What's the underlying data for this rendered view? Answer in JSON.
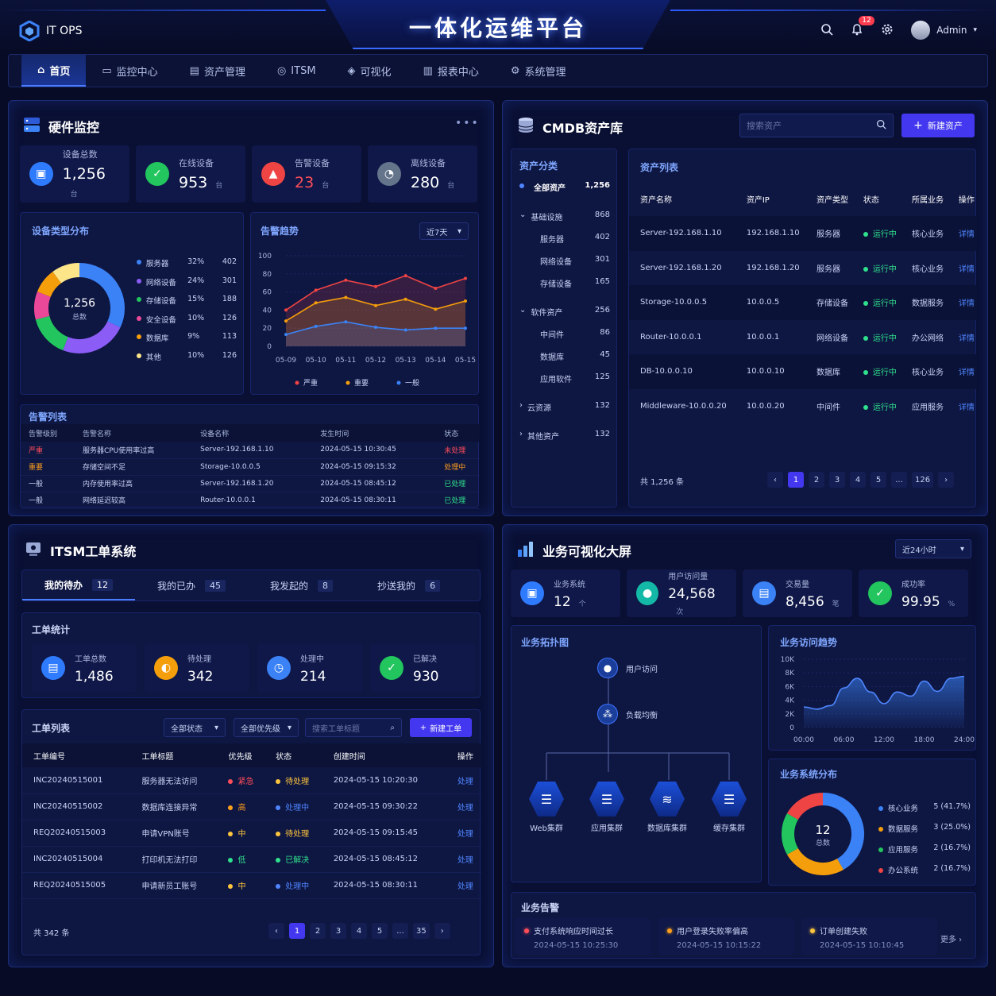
{
  "app": {
    "logo_text": "IT OPS",
    "title": "一体化运维平台",
    "notification_count": "12",
    "user_name": "Admin"
  },
  "nav": [
    {
      "label": "首页",
      "icon": "home-icon"
    },
    {
      "label": "监控中心",
      "icon": "monitor-icon"
    },
    {
      "label": "资产管理",
      "icon": "asset-icon"
    },
    {
      "label": "ITSM",
      "icon": "itsm-icon"
    },
    {
      "label": "可视化",
      "icon": "visual-icon"
    },
    {
      "label": "报表中心",
      "icon": "report-icon"
    },
    {
      "label": "系统管理",
      "icon": "gear-icon"
    }
  ],
  "hw": {
    "title": "硬件监控",
    "stats": [
      {
        "label": "设备总数",
        "value": "1,256",
        "unit": "台",
        "color": "#2f7bff"
      },
      {
        "label": "在线设备",
        "value": "953",
        "unit": "台",
        "color": "#22c55e"
      },
      {
        "label": "告警设备",
        "value": "23",
        "unit": "台",
        "color": "#ef4444"
      },
      {
        "label": "离线设备",
        "value": "280",
        "unit": "台",
        "color": "#64748b"
      }
    ],
    "type_dist": {
      "title": "设备类型分布",
      "center_value": "1,256",
      "center_label": "总数",
      "items": [
        {
          "name": "服务器",
          "pct": "32%",
          "count": "402",
          "color": "#3b82f6"
        },
        {
          "name": "网络设备",
          "pct": "24%",
          "count": "301",
          "color": "#8b5cf6"
        },
        {
          "name": "存储设备",
          "pct": "15%",
          "count": "188",
          "color": "#22c55e"
        },
        {
          "name": "安全设备",
          "pct": "10%",
          "count": "126",
          "color": "#ec4899"
        },
        {
          "name": "数据库",
          "pct": "9%",
          "count": "113",
          "color": "#f59e0b"
        },
        {
          "name": "其他",
          "pct": "10%",
          "count": "126",
          "color": "#fde68a"
        }
      ]
    },
    "alert_trend": {
      "title": "告警趋势",
      "range": "近7天"
    },
    "alert_list": {
      "title": "告警列表",
      "headers": [
        "告警级别",
        "告警名称",
        "设备名称",
        "发生时间",
        "状态"
      ],
      "rows": [
        {
          "level": "严重",
          "name": "服务器CPU使用率过高",
          "device": "Server-192.168.1.10",
          "time": "2024-05-15 10:30:45",
          "status": "未处理",
          "lc": "#ff4e5a",
          "sc": "#ff4e5a"
        },
        {
          "level": "重要",
          "name": "存储空间不足",
          "device": "Storage-10.0.0.5",
          "time": "2024-05-15 09:15:32",
          "status": "处理中",
          "lc": "#ff9f1c",
          "sc": "#ff9f1c"
        },
        {
          "level": "一般",
          "name": "内存使用率过高",
          "device": "Server-192.168.1.20",
          "time": "2024-05-15 08:45:12",
          "status": "已处理",
          "lc": "#c9d4f5",
          "sc": "#2fe08c"
        },
        {
          "level": "一般",
          "name": "网络延迟较高",
          "device": "Router-10.0.0.1",
          "time": "2024-05-15 08:30:11",
          "status": "已处理",
          "lc": "#c9d4f5",
          "sc": "#2fe08c"
        }
      ]
    }
  },
  "cmdb": {
    "title": "CMDB资产库",
    "search_placeholder": "搜索资产",
    "new_button": "新建资产",
    "cat_title": "资产分类",
    "categories": [
      {
        "name": "全部资产",
        "count": "1,256",
        "kind": "all"
      },
      {
        "name": "基础设施",
        "count": "868",
        "kind": "open"
      },
      {
        "name": "服务器",
        "count": "402",
        "kind": "child"
      },
      {
        "name": "网络设备",
        "count": "301",
        "kind": "child"
      },
      {
        "name": "存储设备",
        "count": "165",
        "kind": "child"
      },
      {
        "name": "软件资产",
        "count": "256",
        "kind": "open"
      },
      {
        "name": "中间件",
        "count": "86",
        "kind": "child"
      },
      {
        "name": "数据库",
        "count": "45",
        "kind": "child"
      },
      {
        "name": "应用软件",
        "count": "125",
        "kind": "child"
      },
      {
        "name": "云资源",
        "count": "132",
        "kind": "closed"
      },
      {
        "name": "其他资产",
        "count": "132",
        "kind": "closed"
      }
    ],
    "list_title": "资产列表",
    "headers": [
      "资产名称",
      "资产IP",
      "资产类型",
      "状态",
      "所属业务",
      "操作"
    ],
    "rows": [
      {
        "name": "Server-192.168.1.10",
        "ip": "192.168.1.10",
        "type": "服务器",
        "status": "运行中",
        "biz": "核心业务",
        "op": "详情"
      },
      {
        "name": "Server-192.168.1.20",
        "ip": "192.168.1.20",
        "type": "服务器",
        "status": "运行中",
        "biz": "核心业务",
        "op": "详情"
      },
      {
        "name": "Storage-10.0.0.5",
        "ip": "10.0.0.5",
        "type": "存储设备",
        "status": "运行中",
        "biz": "数据服务",
        "op": "详情"
      },
      {
        "name": "Router-10.0.0.1",
        "ip": "10.0.0.1",
        "type": "网络设备",
        "status": "运行中",
        "biz": "办公网络",
        "op": "详情"
      },
      {
        "name": "DB-10.0.0.10",
        "ip": "10.0.0.10",
        "type": "数据库",
        "status": "运行中",
        "biz": "核心业务",
        "op": "详情"
      },
      {
        "name": "Middleware-10.0.0.20",
        "ip": "10.0.0.20",
        "type": "中间件",
        "status": "运行中",
        "biz": "应用服务",
        "op": "详情"
      }
    ],
    "total": "共 1,256 条",
    "pages": [
      "1",
      "2",
      "3",
      "4",
      "5",
      "...",
      "126"
    ]
  },
  "itsm": {
    "title": "ITSM工单系统",
    "tabs": [
      {
        "label": "我的待办",
        "count": "12"
      },
      {
        "label": "我的已办",
        "count": "45"
      },
      {
        "label": "我发起的",
        "count": "8"
      },
      {
        "label": "抄送我的",
        "count": "6"
      }
    ],
    "stat_title": "工单统计",
    "stats": [
      {
        "label": "工单总数",
        "value": "1,486",
        "color": "#2f7bff"
      },
      {
        "label": "待处理",
        "value": "342",
        "color": "#f59e0b"
      },
      {
        "label": "处理中",
        "value": "214",
        "color": "#3b82f6"
      },
      {
        "label": "已解决",
        "value": "930",
        "color": "#22c55e"
      }
    ],
    "list_title": "工单列表",
    "filter_status": "全部状态",
    "filter_priority": "全部优先级",
    "search_placeholder": "搜索工单标题",
    "new_button": "新建工单",
    "headers": [
      "工单编号",
      "工单标题",
      "优先级",
      "状态",
      "创建时间",
      "操作"
    ],
    "rows": [
      {
        "id": "INC20240515001",
        "title": "服务器无法访问",
        "priority": "紧急",
        "pc": "#ff4e5a",
        "status": "待处理",
        "sc": "#ffc53d",
        "time": "2024-05-15 10:20:30",
        "op": "处理"
      },
      {
        "id": "INC20240515002",
        "title": "数据库连接异常",
        "priority": "高",
        "pc": "#ff9f1c",
        "status": "处理中",
        "sc": "#4f86ff",
        "time": "2024-05-15 09:30:22",
        "op": "处理"
      },
      {
        "id": "REQ20240515003",
        "title": "申请VPN账号",
        "priority": "中",
        "pc": "#ffc53d",
        "status": "待处理",
        "sc": "#ffc53d",
        "time": "2024-05-15 09:15:45",
        "op": "处理"
      },
      {
        "id": "INC20240515004",
        "title": "打印机无法打印",
        "priority": "低",
        "pc": "#2fe08c",
        "status": "已解决",
        "sc": "#2fe08c",
        "time": "2024-05-15 08:45:12",
        "op": "处理"
      },
      {
        "id": "REQ20240515005",
        "title": "申请新员工账号",
        "priority": "中",
        "pc": "#ffc53d",
        "status": "处理中",
        "sc": "#4f86ff",
        "time": "2024-05-15 08:30:11",
        "op": "处理"
      }
    ],
    "total": "共 342 条",
    "pages": [
      "1",
      "2",
      "3",
      "4",
      "5",
      "...",
      "35"
    ]
  },
  "biz": {
    "title": "业务可视化大屏",
    "range": "近24小时",
    "stats": [
      {
        "label": "业务系统",
        "value": "12",
        "unit": "个",
        "color": "#2f7bff"
      },
      {
        "label": "用户访问量",
        "value": "24,568",
        "unit": "次",
        "color": "#14b8a6"
      },
      {
        "label": "交易量",
        "value": "8,456",
        "unit": "笔",
        "color": "#3b82f6"
      },
      {
        "label": "成功率",
        "value": "99.95",
        "unit": "%",
        "color": "#22c55e"
      }
    ],
    "topo": {
      "title": "业务拓扑图",
      "user": "用户访问",
      "lb": "负载均衡",
      "clusters": [
        "Web集群",
        "应用集群",
        "数据库集群",
        "缓存集群"
      ]
    },
    "trend": {
      "title": "业务访问趋势"
    },
    "dist": {
      "title": "业务系统分布",
      "center_value": "12",
      "center_label": "总数",
      "items": [
        {
          "name": "核心业务",
          "value": "5 (41.7%)",
          "color": "#3b82f6"
        },
        {
          "name": "数据服务",
          "value": "3 (25.0%)",
          "color": "#f59e0b"
        },
        {
          "name": "应用服务",
          "value": "2 (16.7%)",
          "color": "#22c55e"
        },
        {
          "name": "办公系统",
          "value": "2 (16.7%)",
          "color": "#ef4444"
        }
      ]
    },
    "alerts": {
      "title": "业务告警",
      "more": "更多 ›",
      "items": [
        {
          "text": "支付系统响应时间过长",
          "time": "2024-05-15 10:25:30",
          "color": "#ff4e5a"
        },
        {
          "text": "用户登录失败率偏高",
          "time": "2024-05-15 10:15:22",
          "color": "#ff9f1c"
        },
        {
          "text": "订单创建失败",
          "time": "2024-05-15 10:10:45",
          "color": "#ffc53d"
        }
      ]
    }
  },
  "chart_data": [
    {
      "type": "pie",
      "title": "设备类型分布",
      "categories": [
        "服务器",
        "网络设备",
        "存储设备",
        "安全设备",
        "数据库",
        "其他"
      ],
      "values": [
        402,
        301,
        188,
        126,
        113,
        126
      ]
    },
    {
      "type": "line",
      "title": "告警趋势",
      "x": [
        "05-09",
        "05-10",
        "05-11",
        "05-12",
        "05-13",
        "05-14",
        "05-15"
      ],
      "ylim": [
        0,
        100
      ],
      "yticks": [
        0,
        20,
        40,
        60,
        80,
        100
      ],
      "series": [
        {
          "name": "严重",
          "color": "#ef4444",
          "values": [
            40,
            62,
            73,
            66,
            78,
            64,
            75
          ]
        },
        {
          "name": "重要",
          "color": "#f59e0b",
          "values": [
            28,
            48,
            54,
            45,
            52,
            41,
            50
          ]
        },
        {
          "name": "一般",
          "color": "#3b82f6",
          "values": [
            13,
            22,
            27,
            21,
            18,
            20,
            20
          ]
        }
      ],
      "legend": "bottom"
    },
    {
      "type": "area",
      "title": "业务访问趋势",
      "x": [
        "00:00",
        "06:00",
        "12:00",
        "18:00",
        "24:00"
      ],
      "ylim": [
        0,
        10000
      ],
      "yticks": [
        "0",
        "2K",
        "4K",
        "6K",
        "8K",
        "10K"
      ],
      "series": [
        {
          "color": "#3b82f6",
          "points": [
            [
              0,
              3000
            ],
            [
              2,
              2700
            ],
            [
              4,
              3200
            ],
            [
              6,
              5800
            ],
            [
              8,
              7200
            ],
            [
              10,
              5200
            ],
            [
              12,
              3500
            ],
            [
              14,
              5200
            ],
            [
              16,
              4600
            ],
            [
              18,
              6800
            ],
            [
              20,
              5300
            ],
            [
              22,
              7200
            ],
            [
              24,
              7500
            ]
          ]
        }
      ]
    },
    {
      "type": "pie",
      "title": "业务系统分布",
      "categories": [
        "核心业务",
        "数据服务",
        "应用服务",
        "办公系统"
      ],
      "values": [
        5,
        3,
        2,
        2
      ]
    }
  ]
}
